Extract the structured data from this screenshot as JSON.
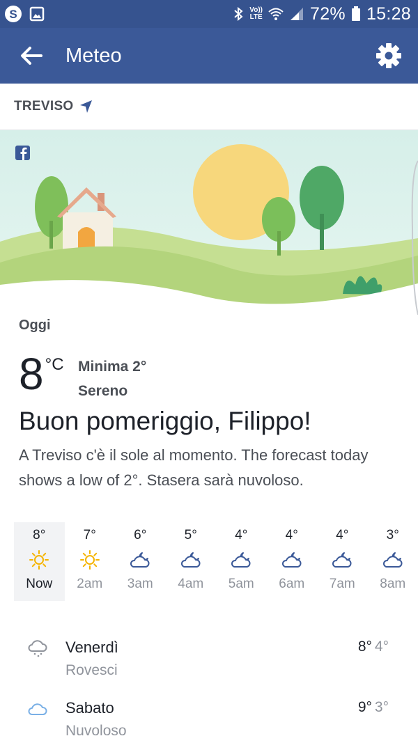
{
  "status_bar": {
    "battery": "72%",
    "time": "15:28",
    "network": "LTE",
    "volte": "Vo))"
  },
  "app_bar": {
    "title": "Meteo"
  },
  "location": {
    "name": "TREVISO"
  },
  "today": {
    "label": "Oggi",
    "temperature": "8",
    "unit": "°C",
    "min": "Minima 2°",
    "condition": "Sereno",
    "greeting": "Buon pomeriggio, Filippo!",
    "summary": "A Treviso c'è il sole al momento. The forecast today shows a low of 2°. Stasera sarà nuvoloso."
  },
  "hourly": [
    {
      "temp": "8°",
      "time": "Now",
      "icon": "sun-icon",
      "active": true
    },
    {
      "temp": "7°",
      "time": "2am",
      "icon": "sun-icon",
      "active": false
    },
    {
      "temp": "6°",
      "time": "3am",
      "icon": "cloud-moon-icon",
      "active": false
    },
    {
      "temp": "5°",
      "time": "4am",
      "icon": "cloud-moon-icon",
      "active": false
    },
    {
      "temp": "4°",
      "time": "5am",
      "icon": "cloud-moon-icon",
      "active": false
    },
    {
      "temp": "4°",
      "time": "6am",
      "icon": "cloud-moon-icon",
      "active": false
    },
    {
      "temp": "4°",
      "time": "7am",
      "icon": "cloud-moon-icon",
      "active": false
    },
    {
      "temp": "3°",
      "time": "8am",
      "icon": "cloud-moon-icon",
      "active": false
    }
  ],
  "daily": [
    {
      "day": "Venerdì",
      "condition": "Rovesci",
      "high": "8°",
      "low": "4°",
      "icon": "rain-cloud-icon"
    },
    {
      "day": "Sabato",
      "condition": "Nuvoloso",
      "high": "9°",
      "low": "3°",
      "icon": "cloud-icon"
    }
  ],
  "colors": {
    "header": "#3b5998",
    "status_bar": "#36538f",
    "sun": "#f5b400",
    "icon_blue": "#3b5998",
    "muted_text": "#90949c"
  }
}
